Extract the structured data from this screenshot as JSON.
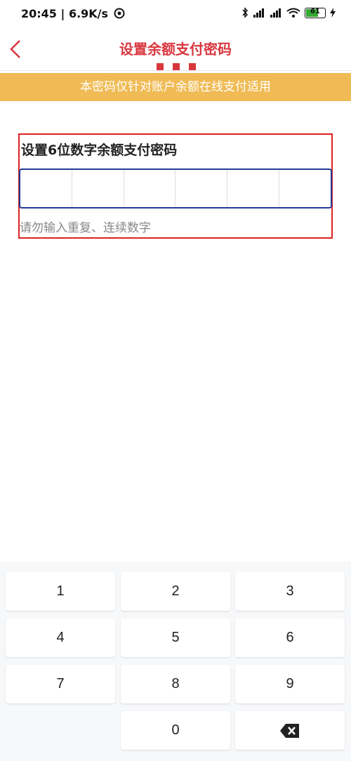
{
  "status": {
    "time": "20:45",
    "speed": "6.9K/s",
    "battery": "61"
  },
  "header": {
    "title": "设置余额支付密码"
  },
  "notice": {
    "text": "本密码仅针对账户余额在线支付适用"
  },
  "form": {
    "label": "设置6位数字余额支付密码",
    "hint": "请勿输入重复、连续数字"
  },
  "keypad": {
    "keys": [
      "1",
      "2",
      "3",
      "4",
      "5",
      "6",
      "7",
      "8",
      "9",
      "0"
    ]
  },
  "colors": {
    "accent": "#d9363e",
    "notice_bg": "#f0bb55",
    "input_border": "#233b99",
    "highlight_box": "#dd2222"
  }
}
